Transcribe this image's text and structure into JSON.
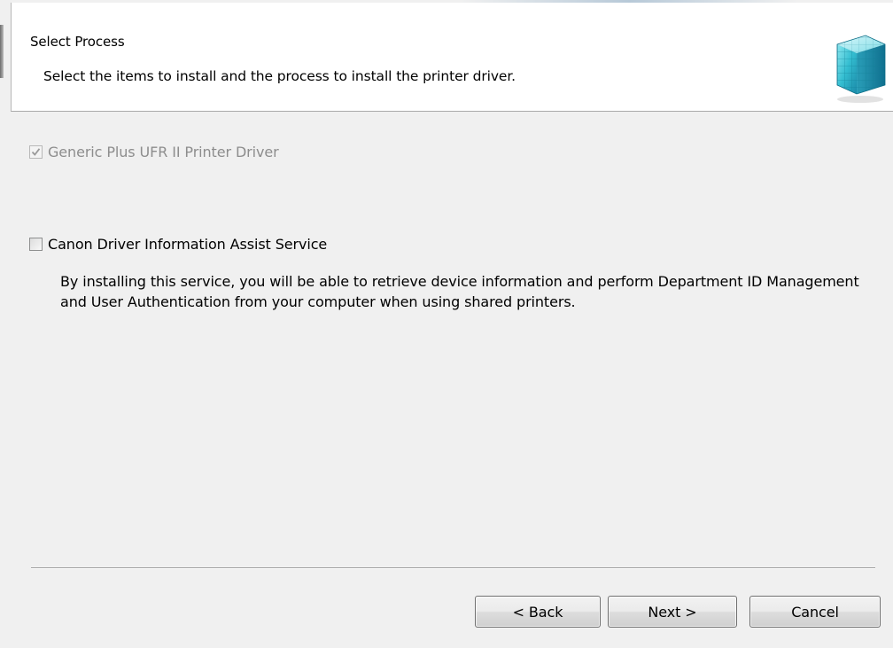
{
  "header": {
    "title": "Select Process",
    "subtitle": "Select the items to install and the process to install the printer driver.",
    "logo_icon": "cube-grid-logo-icon"
  },
  "options": [
    {
      "label": "Generic Plus UFR II Printer Driver",
      "checked": true,
      "enabled": false
    },
    {
      "label": "Canon Driver Information Assist Service",
      "checked": false,
      "enabled": true,
      "description": "By installing this service, you will be able to retrieve device information and perform Department ID Management and User Authentication from your computer when using shared printers."
    }
  ],
  "buttons": {
    "back": "< Back",
    "next": "Next >",
    "cancel": "Cancel"
  },
  "colors": {
    "background": "#f0f0f0",
    "header_background": "#ffffff",
    "disabled_text": "#8d8d8d",
    "logo_accent": "#2fb8c9"
  }
}
